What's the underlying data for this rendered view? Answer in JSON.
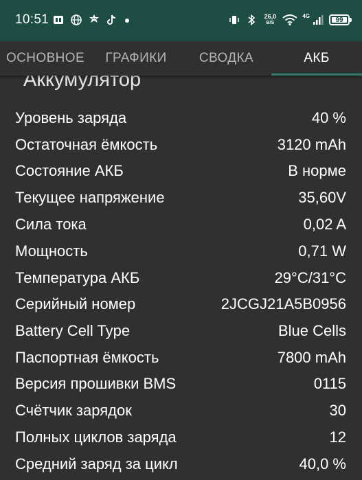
{
  "status_bar": {
    "time": "10:51",
    "net_speed_value": "26,0",
    "net_speed_unit": "B/S",
    "network_type": "4G",
    "battery_percent": "99",
    "battery_level": 0.99,
    "left_icons": [
      "sim-toolkit-icon",
      "globe-icon",
      "robot-icon",
      "tiktok-icon",
      "notification-dot-icon"
    ],
    "right_icons": [
      "vibrate-icon",
      "bluetooth-icon",
      "wifi-icon",
      "signal-icon",
      "battery-icon"
    ],
    "background_color": "#1e4d44"
  },
  "tabs": [
    {
      "label": "ОСНОВНОЕ",
      "active": false
    },
    {
      "label": "ГРАФИКИ",
      "active": false
    },
    {
      "label": "СВОДКА",
      "active": false
    },
    {
      "label": "АКБ",
      "active": true
    }
  ],
  "accent_color": "#2f7d6e",
  "section": {
    "title": "Аккумулятор"
  },
  "rows": [
    {
      "label": "Уровень заряда",
      "value": "40 %"
    },
    {
      "label": "Остаточная ёмкость",
      "value": "3120 mAh"
    },
    {
      "label": "Состояние АКБ",
      "value": "В норме"
    },
    {
      "label": "Текущее напряжение",
      "value": "35,60V"
    },
    {
      "label": "Сила тока",
      "value": "0,02 A"
    },
    {
      "label": "Мощность",
      "value": "0,71 W"
    },
    {
      "label": "Температура АКБ",
      "value": "29°C/31°C"
    },
    {
      "label": "Серийный номер",
      "value": "2JCGJ21A5B0956"
    },
    {
      "label": "Battery Cell Type",
      "value": "Blue Cells"
    },
    {
      "label": "Паспортная ёмкость",
      "value": "7800 mAh"
    },
    {
      "label": "Версия прошивки BMS",
      "value": "0115"
    },
    {
      "label": "Счётчик зарядок",
      "value": "30"
    },
    {
      "label": "Полных циклов заряда",
      "value": "12"
    },
    {
      "label": "Средний заряд за цикл",
      "value": "40,0 %"
    }
  ]
}
